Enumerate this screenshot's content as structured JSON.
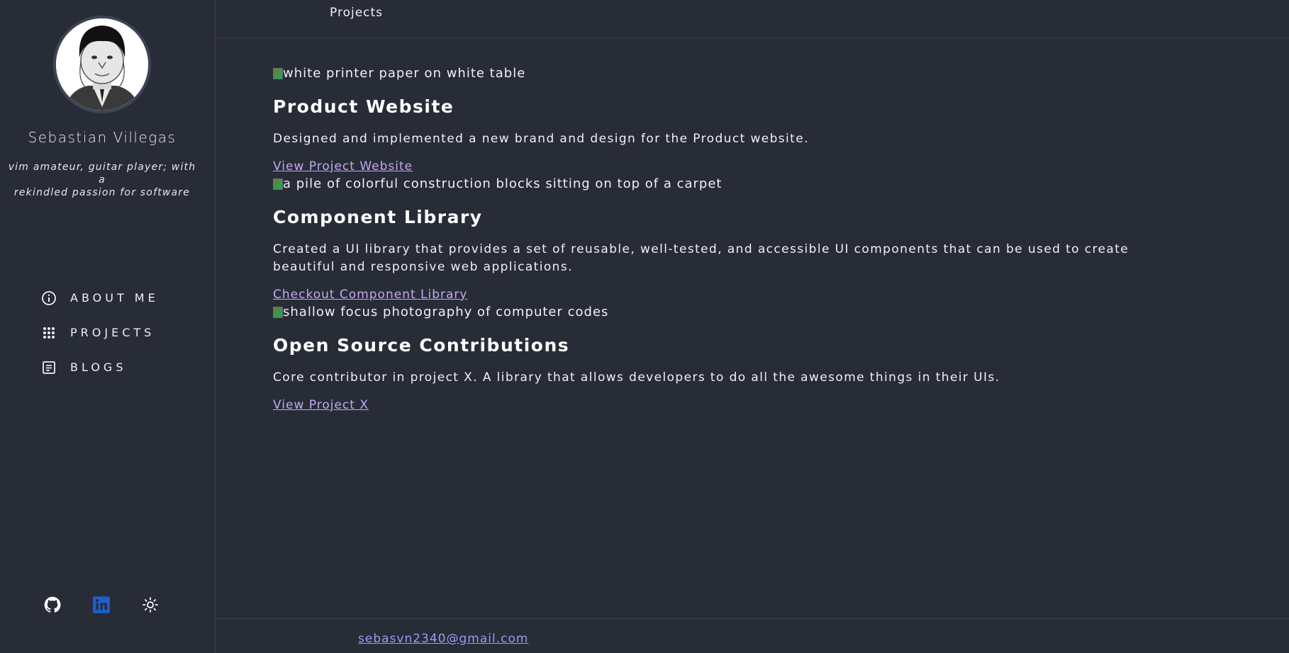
{
  "sidebar": {
    "profile": {
      "name": "Sebastian Villegas",
      "bio_line1": "vim amateur, guitar player; with a",
      "bio_line2": "rekindled passion for software"
    },
    "nav": [
      {
        "label": "ABOUT ME",
        "icon": "info-icon"
      },
      {
        "label": "PROJECTS",
        "icon": "grid-dots-icon"
      },
      {
        "label": "BLOGS",
        "icon": "document-icon"
      }
    ],
    "socials": [
      {
        "icon": "github-icon",
        "color": "#ffffff"
      },
      {
        "icon": "linkedin-icon",
        "color": "#1d5fc7"
      },
      {
        "icon": "sun-icon",
        "color": "#ffffff"
      }
    ]
  },
  "header": {
    "title": "Projects"
  },
  "projects": [
    {
      "image_alt": "white printer paper on white table",
      "title": "Product Website",
      "description": "Designed and implemented a new brand and design for the Product website.",
      "link_label": "View Project Website"
    },
    {
      "image_alt": "a pile of colorful construction blocks sitting on top of a carpet",
      "title": "Component Library",
      "description": "Created a UI library that provides a set of reusable, well-tested, and accessible UI components that can be used to create beautiful and responsive web applications.",
      "link_label": "Checkout Component Library"
    },
    {
      "image_alt": "shallow focus photography of computer codes",
      "title": "Open Source Contributions",
      "description": "Core contributor in project X. A library that allows developers to do all the awesome things in their UIs.",
      "link_label": "View Project X"
    }
  ],
  "footer": {
    "email": "sebasvn2340@gmail.com"
  },
  "colors": {
    "background": "#282c37",
    "link": "#c4a8f2",
    "footer_link": "#9a9bf7",
    "linkedin": "#1d5fc7"
  }
}
